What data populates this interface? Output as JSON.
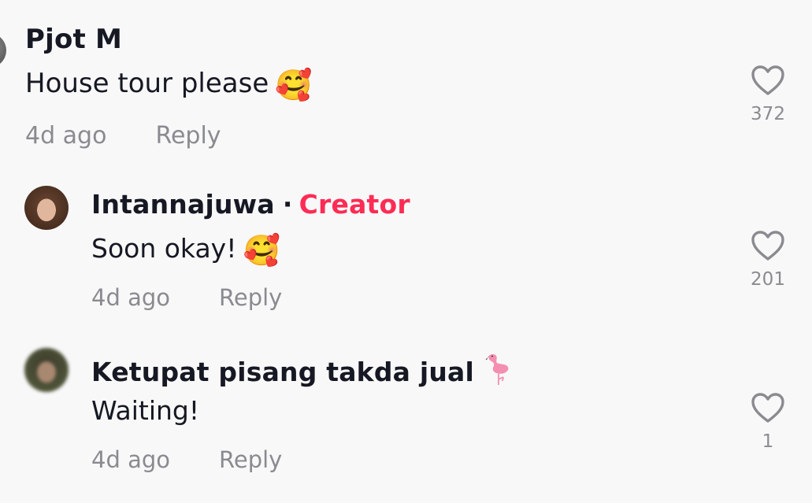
{
  "comments": [
    {
      "username": "Pjot M",
      "text": "House tour please",
      "emoji": "🥰",
      "time": "4d ago",
      "reply_label": "Reply",
      "likes": "372"
    },
    {
      "username": "Intannajuwa",
      "separator": "·",
      "badge": "Creator",
      "text": "Soon okay!",
      "emoji": "🥰",
      "time": "4d ago",
      "reply_label": "Reply",
      "likes": "201"
    },
    {
      "username": "Ketupat pisang takda jual",
      "username_icon": "flamingo-icon",
      "text": "Waiting!",
      "time": "4d ago",
      "reply_label": "Reply",
      "likes": "1"
    }
  ],
  "colors": {
    "background": "#f8f8f8",
    "text_primary": "#161823",
    "text_secondary": "#8a8b91",
    "creator_badge": "#fe2c55"
  }
}
